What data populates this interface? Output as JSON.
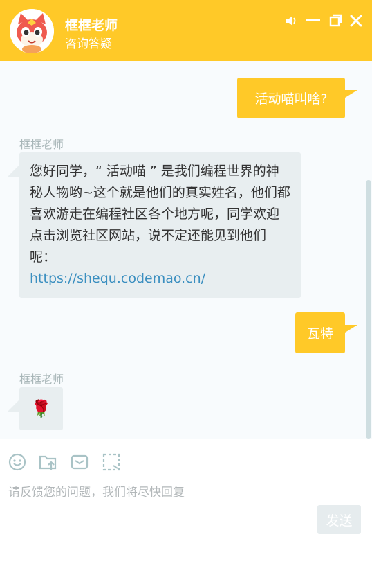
{
  "header": {
    "title": "框框老师",
    "subtitle": "咨询答疑",
    "buttons": [
      "volume-icon",
      "minimize-icon",
      "maximize-icon",
      "close-icon"
    ]
  },
  "messages": [
    {
      "from": "user",
      "text": "活动喵叫啥?"
    },
    {
      "from": "agent",
      "sender": "框框老师",
      "text": "您好同学，“ 活动喵 ” 是我们编程世界的神秘人物哟~这个就是他们的真实姓名，他们都喜欢游走在编程社区各个地方呢，同学欢迎点击浏览社区网站，说不定还能见到他们呢：",
      "link": "https://shequ.codemao.cn/"
    },
    {
      "from": "user",
      "text": "瓦特"
    },
    {
      "from": "agent",
      "sender": "框框老师",
      "emoji": "🌹"
    }
  ],
  "toolbar": {
    "icons": [
      "emoji-icon",
      "upload-file-icon",
      "mail-icon",
      "screenshot-icon"
    ]
  },
  "composer": {
    "placeholder": "请反馈您的问题，我们将尽快回复",
    "send_label": "发送"
  },
  "colors": {
    "accent": "#ffc928",
    "bubble_agent": "#e8eef0",
    "link": "#3b8fc0"
  }
}
